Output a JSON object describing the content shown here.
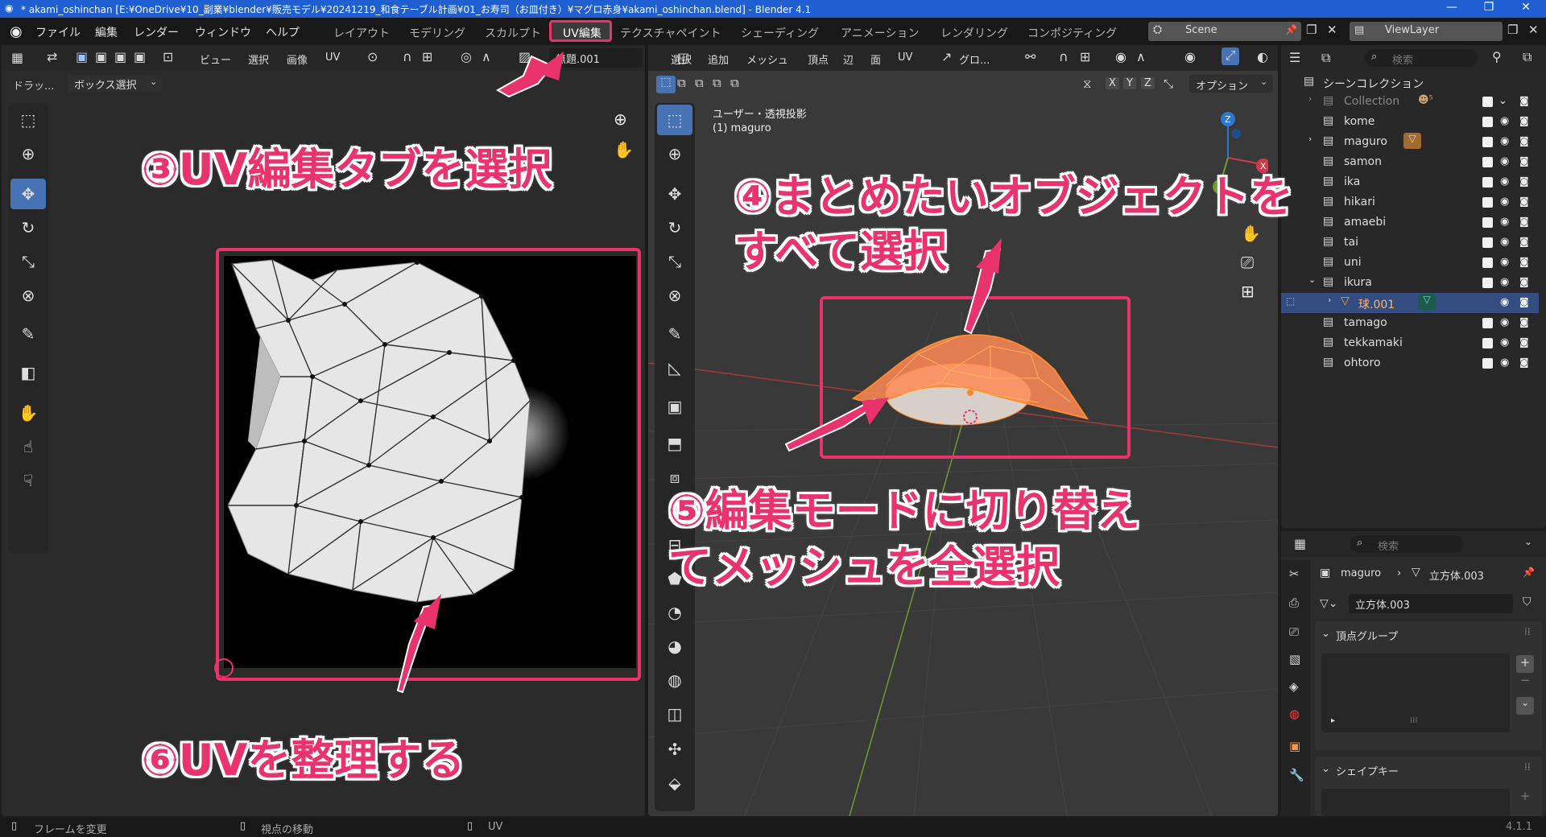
{
  "titlebar": {
    "title": "* akami_oshinchan [E:¥OneDrive¥10_副業¥blender¥販売モデル¥20241219_和食テーブル計画¥01_お寿司（お皿付き）¥マグロ赤身¥akami_oshinchan.blend] - Blender 4.1",
    "minimize": "—",
    "maximize": "❐",
    "close": "✕"
  },
  "menu": [
    "ファイル",
    "編集",
    "レンダー",
    "ウィンドウ",
    "ヘルプ"
  ],
  "workspaces": [
    "レイアウト",
    "モデリング",
    "スカルプト",
    "UV編集",
    "テクスチャペイント",
    "シェーディング",
    "アニメーション",
    "レンダリング",
    "コンポジティング"
  ],
  "active_workspace": "UV編集",
  "scene": "Scene",
  "viewlayer": "ViewLayer",
  "uv_editor": {
    "header_items": [
      "ビュー",
      "選択",
      "画像",
      "UV"
    ],
    "image_name": "無題.001",
    "drag_label": "ドラッ...",
    "drag_mode": "ボックス選択"
  },
  "viewport": {
    "header_items": [
      "選択",
      "追加",
      "メッシュ",
      "頂点",
      "辺",
      "面",
      "UV"
    ],
    "transform": "グロ...",
    "view_name": "ユーザー・透視投影",
    "object_label": "(1) maguro",
    "axes": [
      "X",
      "Y",
      "Z"
    ],
    "options": "オプション"
  },
  "outliner": {
    "search_placeholder": "検索",
    "root": "シーンコレクション",
    "items": [
      {
        "name": "Collection",
        "dim": true
      },
      {
        "name": "kome"
      },
      {
        "name": "maguro"
      },
      {
        "name": "samon"
      },
      {
        "name": "ika"
      },
      {
        "name": "hikari"
      },
      {
        "name": "amaebi"
      },
      {
        "name": "tai"
      },
      {
        "name": "uni"
      },
      {
        "name": "ikura"
      },
      {
        "name": "球.001",
        "selected": true
      },
      {
        "name": "tamago"
      },
      {
        "name": "tekkamaki"
      },
      {
        "name": "ohtoro"
      }
    ]
  },
  "properties": {
    "search_placeholder": "検索",
    "breadcrumb_object": "maguro",
    "breadcrumb_mesh": "立方体.003",
    "mesh_field": "立方体.003",
    "vertex_groups": "頂点グループ",
    "shape_keys": "シェイプキー"
  },
  "statusbar": {
    "left": "フレームを変更",
    "middle": "視点の移動",
    "right": "UV",
    "version": "4.1.1"
  },
  "annotations": {
    "a3": "③UV編集タブを選択",
    "a4_line1": "④まとめたいオブジェクトを",
    "a4_line2": "すべて選択",
    "a5_line1": "⑤編集モードに切り替え",
    "a5_line2": "てメッシュを全選択",
    "a6": "⑥UVを整理する"
  },
  "colors": {
    "accent": "#e8336d",
    "selected_tool": "#4772b3",
    "title_bar": "#1f5fd1",
    "mesh_orange": "#ff8a2a"
  }
}
